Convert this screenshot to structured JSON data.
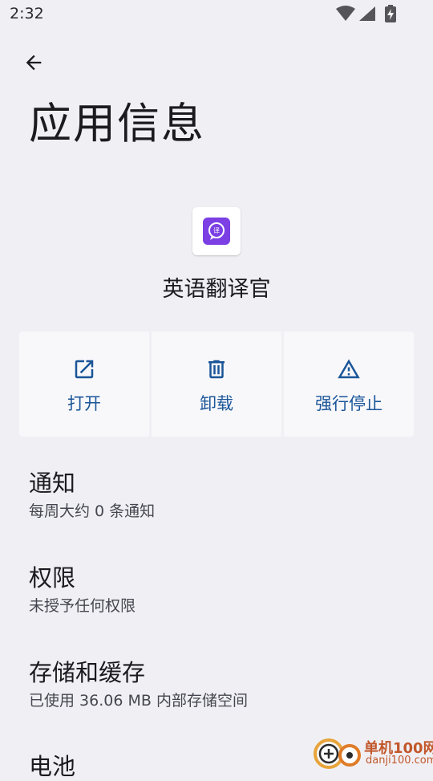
{
  "status_bar": {
    "time": "2:32"
  },
  "page": {
    "title": "应用信息"
  },
  "app": {
    "name": "英语翻译官",
    "icon": "translator-app-icon",
    "icon_color": "#7b3fe4"
  },
  "actions": [
    {
      "label": "打开",
      "icon": "open-external-icon"
    },
    {
      "label": "卸载",
      "icon": "trash-icon"
    },
    {
      "label": "强行停止",
      "icon": "warning-triangle-icon"
    }
  ],
  "settings": [
    {
      "title": "通知",
      "summary": "每周大约 0 条通知"
    },
    {
      "title": "权限",
      "summary": "未授予任何权限"
    },
    {
      "title": "存储和缓存",
      "summary": "已使用 36.06 MB 内部存储空间"
    },
    {
      "title": "电池"
    }
  ],
  "watermark": {
    "text": "单机100网",
    "url": "danji100.com"
  },
  "colors": {
    "accent": "#1a5598",
    "background": "#f0f0f4",
    "card": "#f8f8fb",
    "watermark": "#c2572b"
  }
}
